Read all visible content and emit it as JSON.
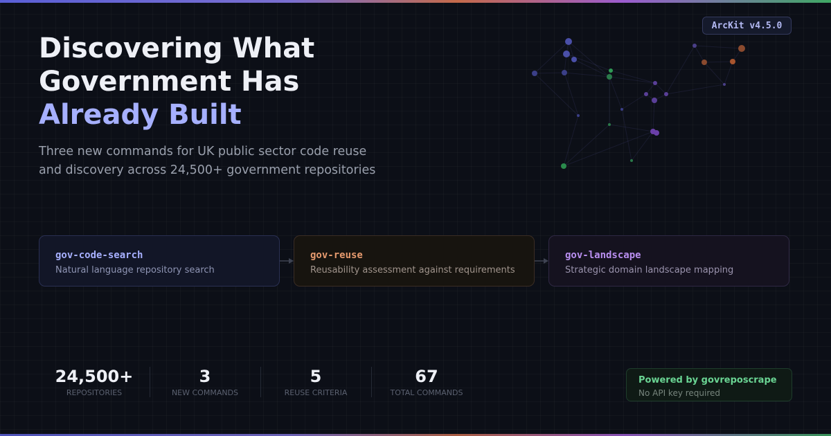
{
  "version_badge": "ArcKit v4.5.0",
  "headline": {
    "line1": "Discovering What",
    "line2": "Government Has",
    "line3_accent": "Already Built"
  },
  "subtitle": {
    "line1": "Three new commands for UK public sector code reuse",
    "line2": "and discovery across 24,500+ government repositories"
  },
  "commands": [
    {
      "name": "gov-code-search",
      "description": "Natural language repository search"
    },
    {
      "name": "gov-reuse",
      "description": "Reusability assessment against requirements"
    },
    {
      "name": "gov-landscape",
      "description": "Strategic domain landscape mapping"
    }
  ],
  "stats": [
    {
      "value": "24,500+",
      "label": "REPOSITORIES"
    },
    {
      "value": "3",
      "label": "NEW COMMANDS"
    },
    {
      "value": "5",
      "label": "REUSE CRITERIA"
    },
    {
      "value": "67",
      "label": "TOTAL COMMANDS"
    }
  ],
  "powered_by": {
    "title": "Powered by govreposcrape",
    "subtitle": "No API key required"
  },
  "colors": {
    "background": "#0c0f17",
    "accent_blue": "#a6b0ff",
    "accent_orange": "#e69a6e",
    "accent_purple": "#b98ff0",
    "accent_green": "#6ad493"
  },
  "icons": {
    "flow_arrow": "arrow-right-icon",
    "network_graph": "network-graph-icon"
  }
}
